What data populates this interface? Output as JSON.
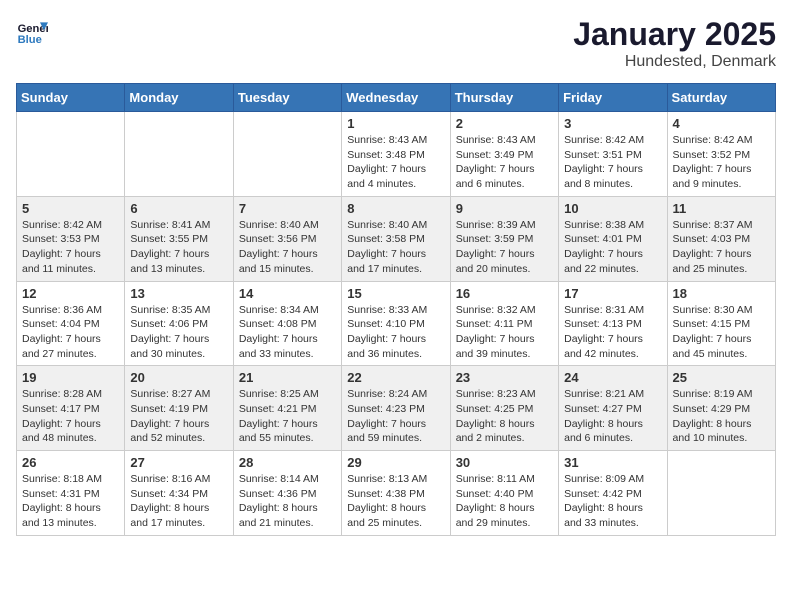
{
  "logo": {
    "line1": "General",
    "line2": "Blue"
  },
  "title": "January 2025",
  "subtitle": "Hundested, Denmark",
  "days_of_week": [
    "Sunday",
    "Monday",
    "Tuesday",
    "Wednesday",
    "Thursday",
    "Friday",
    "Saturday"
  ],
  "weeks": [
    [
      {
        "day": "",
        "info": ""
      },
      {
        "day": "",
        "info": ""
      },
      {
        "day": "",
        "info": ""
      },
      {
        "day": "1",
        "info": "Sunrise: 8:43 AM\nSunset: 3:48 PM\nDaylight: 7 hours\nand 4 minutes."
      },
      {
        "day": "2",
        "info": "Sunrise: 8:43 AM\nSunset: 3:49 PM\nDaylight: 7 hours\nand 6 minutes."
      },
      {
        "day": "3",
        "info": "Sunrise: 8:42 AM\nSunset: 3:51 PM\nDaylight: 7 hours\nand 8 minutes."
      },
      {
        "day": "4",
        "info": "Sunrise: 8:42 AM\nSunset: 3:52 PM\nDaylight: 7 hours\nand 9 minutes."
      }
    ],
    [
      {
        "day": "5",
        "info": "Sunrise: 8:42 AM\nSunset: 3:53 PM\nDaylight: 7 hours\nand 11 minutes."
      },
      {
        "day": "6",
        "info": "Sunrise: 8:41 AM\nSunset: 3:55 PM\nDaylight: 7 hours\nand 13 minutes."
      },
      {
        "day": "7",
        "info": "Sunrise: 8:40 AM\nSunset: 3:56 PM\nDaylight: 7 hours\nand 15 minutes."
      },
      {
        "day": "8",
        "info": "Sunrise: 8:40 AM\nSunset: 3:58 PM\nDaylight: 7 hours\nand 17 minutes."
      },
      {
        "day": "9",
        "info": "Sunrise: 8:39 AM\nSunset: 3:59 PM\nDaylight: 7 hours\nand 20 minutes."
      },
      {
        "day": "10",
        "info": "Sunrise: 8:38 AM\nSunset: 4:01 PM\nDaylight: 7 hours\nand 22 minutes."
      },
      {
        "day": "11",
        "info": "Sunrise: 8:37 AM\nSunset: 4:03 PM\nDaylight: 7 hours\nand 25 minutes."
      }
    ],
    [
      {
        "day": "12",
        "info": "Sunrise: 8:36 AM\nSunset: 4:04 PM\nDaylight: 7 hours\nand 27 minutes."
      },
      {
        "day": "13",
        "info": "Sunrise: 8:35 AM\nSunset: 4:06 PM\nDaylight: 7 hours\nand 30 minutes."
      },
      {
        "day": "14",
        "info": "Sunrise: 8:34 AM\nSunset: 4:08 PM\nDaylight: 7 hours\nand 33 minutes."
      },
      {
        "day": "15",
        "info": "Sunrise: 8:33 AM\nSunset: 4:10 PM\nDaylight: 7 hours\nand 36 minutes."
      },
      {
        "day": "16",
        "info": "Sunrise: 8:32 AM\nSunset: 4:11 PM\nDaylight: 7 hours\nand 39 minutes."
      },
      {
        "day": "17",
        "info": "Sunrise: 8:31 AM\nSunset: 4:13 PM\nDaylight: 7 hours\nand 42 minutes."
      },
      {
        "day": "18",
        "info": "Sunrise: 8:30 AM\nSunset: 4:15 PM\nDaylight: 7 hours\nand 45 minutes."
      }
    ],
    [
      {
        "day": "19",
        "info": "Sunrise: 8:28 AM\nSunset: 4:17 PM\nDaylight: 7 hours\nand 48 minutes."
      },
      {
        "day": "20",
        "info": "Sunrise: 8:27 AM\nSunset: 4:19 PM\nDaylight: 7 hours\nand 52 minutes."
      },
      {
        "day": "21",
        "info": "Sunrise: 8:25 AM\nSunset: 4:21 PM\nDaylight: 7 hours\nand 55 minutes."
      },
      {
        "day": "22",
        "info": "Sunrise: 8:24 AM\nSunset: 4:23 PM\nDaylight: 7 hours\nand 59 minutes."
      },
      {
        "day": "23",
        "info": "Sunrise: 8:23 AM\nSunset: 4:25 PM\nDaylight: 8 hours\nand 2 minutes."
      },
      {
        "day": "24",
        "info": "Sunrise: 8:21 AM\nSunset: 4:27 PM\nDaylight: 8 hours\nand 6 minutes."
      },
      {
        "day": "25",
        "info": "Sunrise: 8:19 AM\nSunset: 4:29 PM\nDaylight: 8 hours\nand 10 minutes."
      }
    ],
    [
      {
        "day": "26",
        "info": "Sunrise: 8:18 AM\nSunset: 4:31 PM\nDaylight: 8 hours\nand 13 minutes."
      },
      {
        "day": "27",
        "info": "Sunrise: 8:16 AM\nSunset: 4:34 PM\nDaylight: 8 hours\nand 17 minutes."
      },
      {
        "day": "28",
        "info": "Sunrise: 8:14 AM\nSunset: 4:36 PM\nDaylight: 8 hours\nand 21 minutes."
      },
      {
        "day": "29",
        "info": "Sunrise: 8:13 AM\nSunset: 4:38 PM\nDaylight: 8 hours\nand 25 minutes."
      },
      {
        "day": "30",
        "info": "Sunrise: 8:11 AM\nSunset: 4:40 PM\nDaylight: 8 hours\nand 29 minutes."
      },
      {
        "day": "31",
        "info": "Sunrise: 8:09 AM\nSunset: 4:42 PM\nDaylight: 8 hours\nand 33 minutes."
      },
      {
        "day": "",
        "info": ""
      }
    ]
  ]
}
